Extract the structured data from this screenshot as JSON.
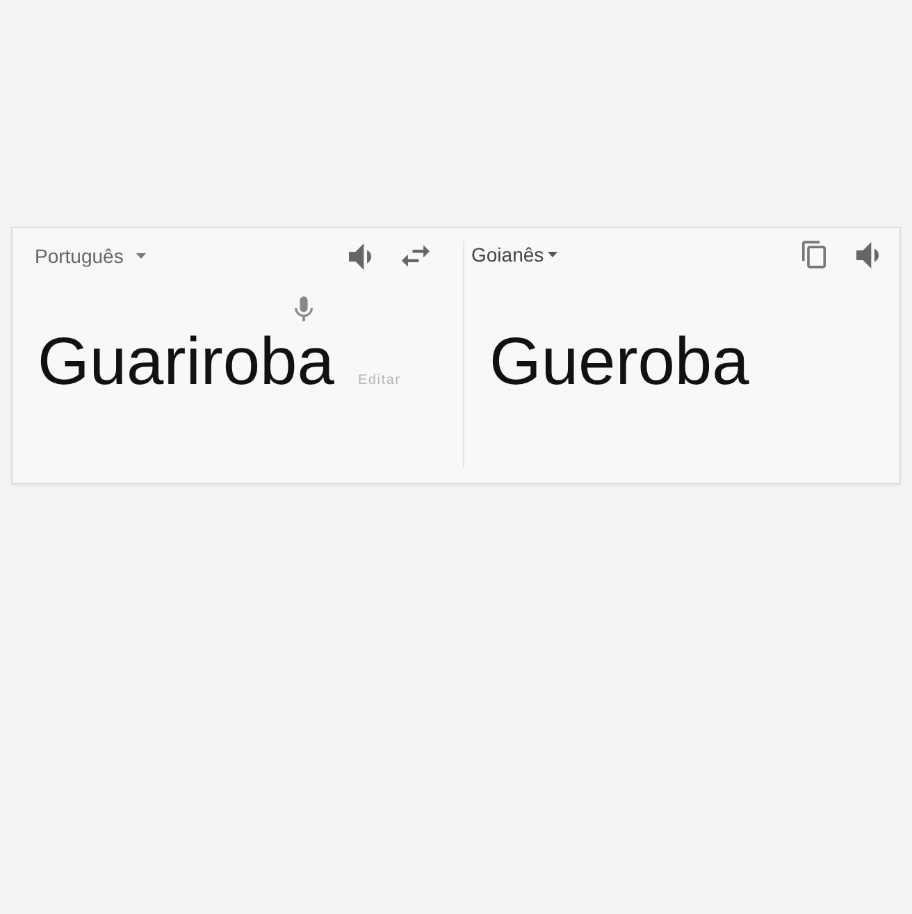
{
  "source": {
    "language": "Português",
    "text": "Guariroba",
    "edit_link": "Editar"
  },
  "target": {
    "language": "Goianês",
    "text": "Gueroba"
  }
}
